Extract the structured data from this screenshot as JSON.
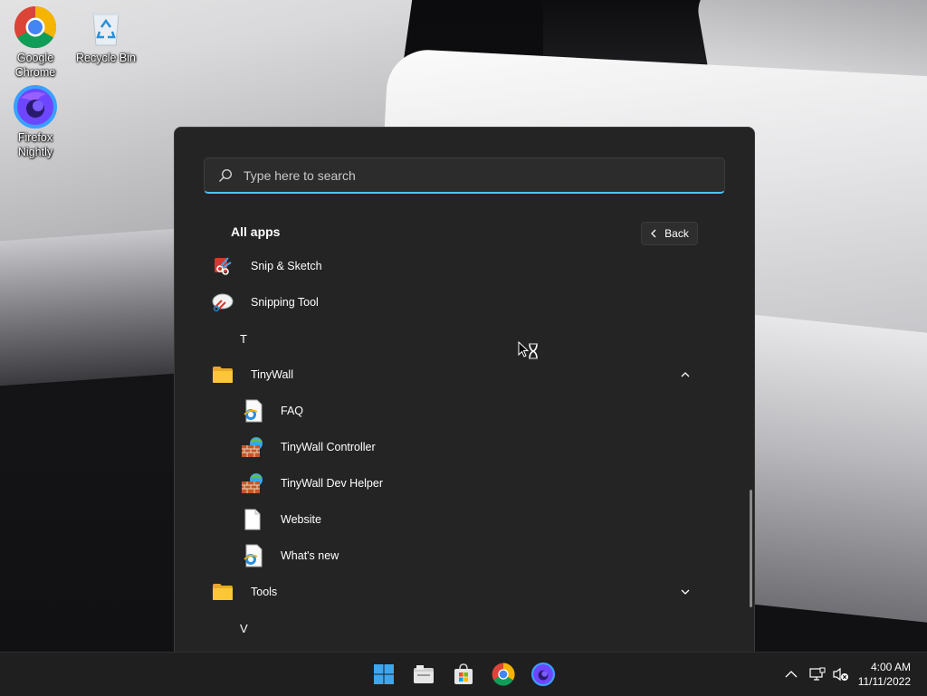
{
  "desktop": {
    "icons": [
      {
        "label": "Google Chrome",
        "icon": "chrome-icon"
      },
      {
        "label": "Recycle Bin",
        "icon": "recycle-bin-icon"
      },
      {
        "label": "Firefox Nightly",
        "icon": "firefox-nightly-icon"
      }
    ]
  },
  "start_menu": {
    "search": {
      "placeholder": "Type here to search",
      "value": ""
    },
    "all_apps_title": "All apps",
    "back_label": "Back",
    "items": [
      {
        "type": "app",
        "label": "Snip & Sketch",
        "icon": "snip-sketch-icon"
      },
      {
        "type": "app",
        "label": "Snipping Tool",
        "icon": "snipping-tool-icon"
      },
      {
        "type": "letter",
        "label": "T"
      },
      {
        "type": "folder",
        "label": "TinyWall",
        "icon": "folder-icon",
        "expanded": true
      },
      {
        "type": "subapp",
        "label": "FAQ",
        "icon": "ie-document-icon"
      },
      {
        "type": "subapp",
        "label": "TinyWall Controller",
        "icon": "tinywall-icon"
      },
      {
        "type": "subapp",
        "label": "TinyWall Dev Helper",
        "icon": "tinywall-icon"
      },
      {
        "type": "subapp",
        "label": "Website",
        "icon": "document-icon"
      },
      {
        "type": "subapp",
        "label": "What's new",
        "icon": "ie-document-icon"
      },
      {
        "type": "folder",
        "label": "Tools",
        "icon": "folder-icon",
        "expanded": false
      },
      {
        "type": "letter",
        "label": "V"
      }
    ]
  },
  "taskbar": {
    "apps": [
      "start-icon",
      "file-explorer-icon",
      "microsoft-store-icon",
      "chrome-icon",
      "firefox-nightly-icon"
    ],
    "clock": {
      "time": "4:00 AM",
      "date": "11/11/2022"
    },
    "tray": [
      "chevron-up-icon",
      "network-icon",
      "volume-muted-icon"
    ]
  },
  "colors": {
    "accent": "#4cc2ff",
    "menu_bg": "#242424",
    "taskbar_bg": "#1f1f1f"
  }
}
